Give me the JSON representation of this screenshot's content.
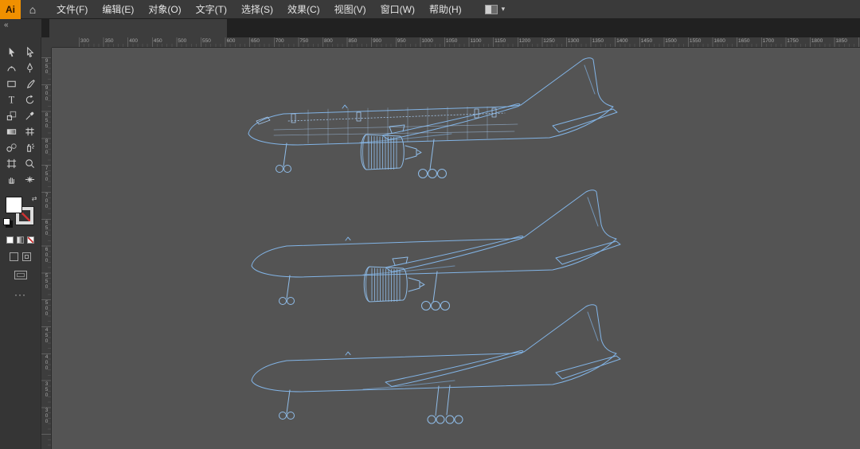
{
  "app": {
    "logo_text": "Ai",
    "home_icon": "⌂"
  },
  "menubar": {
    "items": [
      "文件(F)",
      "编辑(E)",
      "对象(O)",
      "文字(T)",
      "选择(S)",
      "效果(C)",
      "视图(V)",
      "窗口(W)",
      "帮助(H)"
    ]
  },
  "workspace": {
    "chevron": "▾"
  },
  "toolbar": {
    "collapse_label": "«",
    "more_label": "···",
    "swap_icon": "⇄",
    "tools": [
      "selection",
      "direct-selection",
      "curvature",
      "pen",
      "rectangle",
      "paintbrush",
      "type",
      "rotate",
      "scale",
      "eyedropper",
      "gradient",
      "mesh",
      "blend",
      "symbol-sprayer",
      "artboard",
      "zoom",
      "hand",
      "width"
    ]
  },
  "rulers": {
    "horizontal": [
      300,
      350,
      400,
      450,
      500,
      550,
      600,
      650,
      700,
      750,
      800,
      850,
      900,
      950,
      1000,
      1050,
      1100,
      1150,
      1200,
      1250,
      1300,
      1350,
      1400,
      1450,
      1500,
      1550,
      1600,
      1650,
      1700,
      1750,
      1800,
      1850
    ],
    "vertical": [
      950,
      900,
      850,
      800,
      750,
      700,
      650,
      600,
      550,
      500,
      450,
      400,
      350,
      300
    ]
  },
  "canvas": {
    "background": "#545454",
    "artwork_stroke": "#7fb2e4",
    "objects": [
      {
        "name": "airplane-side-view-detailed-wireframe"
      },
      {
        "name": "airplane-side-view-outline-with-engine"
      },
      {
        "name": "airplane-side-view-outline"
      }
    ]
  }
}
